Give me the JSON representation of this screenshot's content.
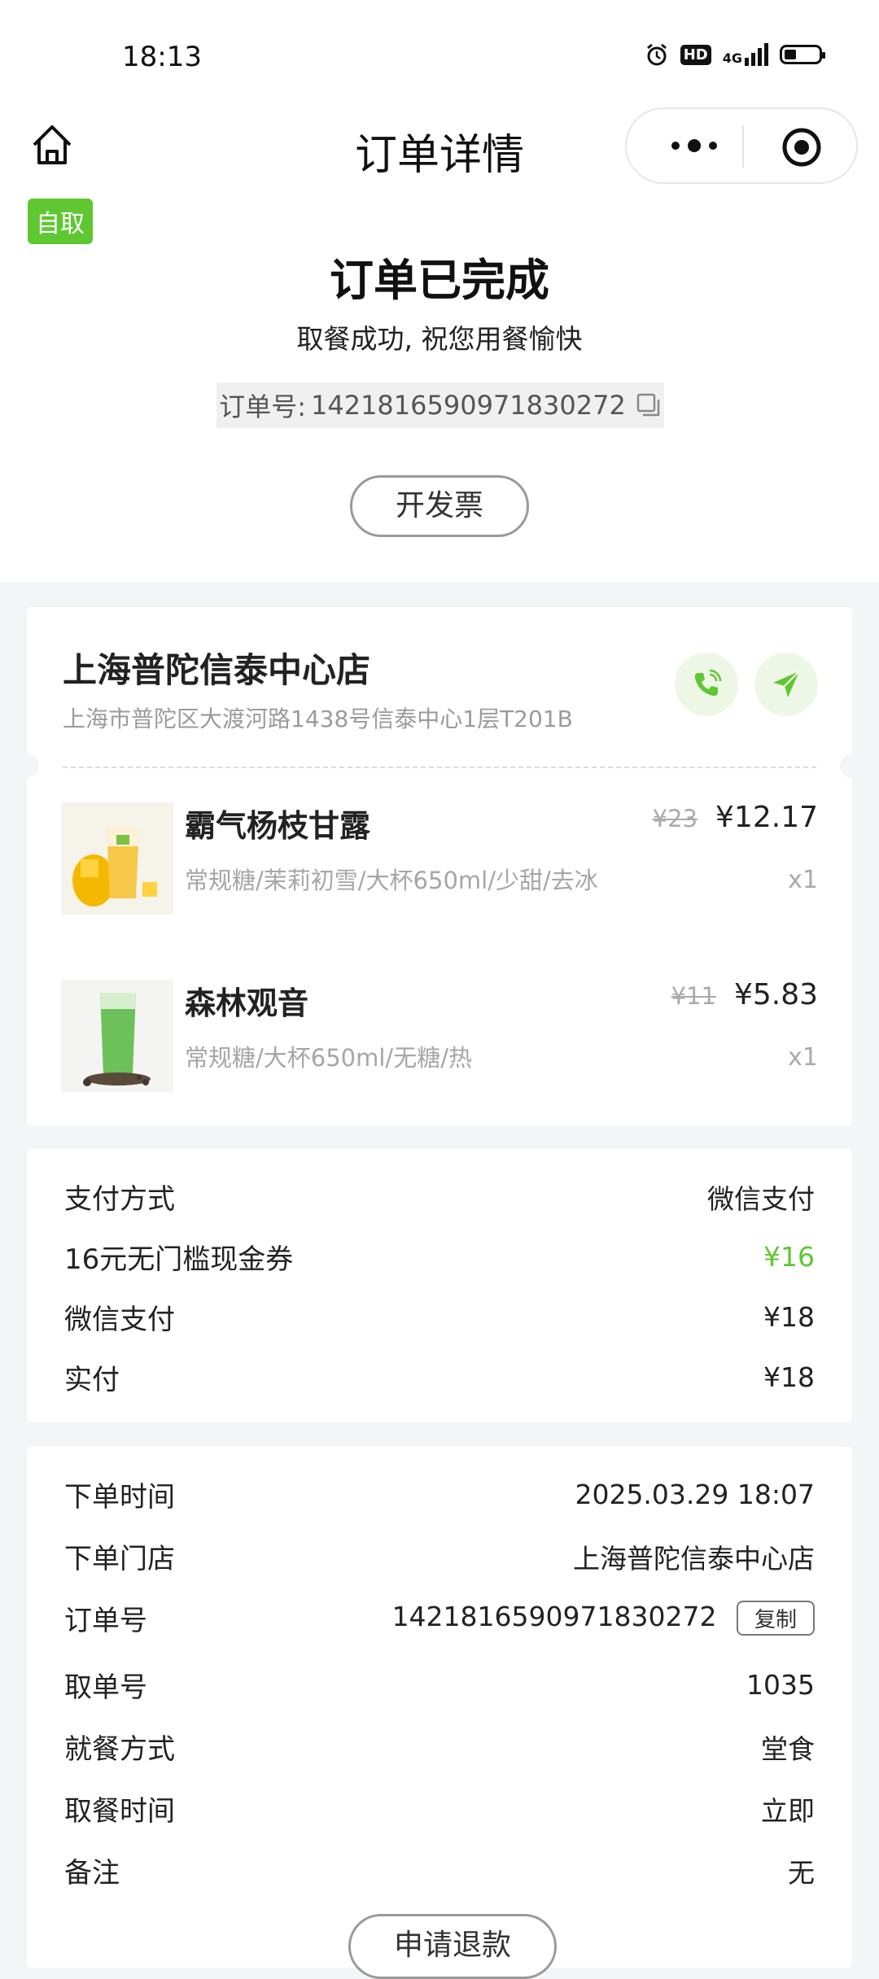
{
  "status_bar": {
    "time": "18:13",
    "hd_label": "HD",
    "network": "4G"
  },
  "nav": {
    "title": "订单详情"
  },
  "order_status": {
    "tag": "自取",
    "title": "订单已完成",
    "subtitle": "取餐成功, 祝您用餐愉快",
    "order_no_label": "订单号:",
    "order_no": "1421816590971830272",
    "invoice_button": "开发票"
  },
  "store": {
    "name": "上海普陀信泰中心店",
    "address": "上海市普陀区大渡河路1438号信泰中心1层T201B"
  },
  "products": [
    {
      "name": "霸气杨枝甘露",
      "options": "常规糖/茉莉初雪/大杯650ml/少甜/去冰",
      "original_price": "¥23",
      "price": "¥12.17",
      "qty": "x1",
      "image": "mango-drink"
    },
    {
      "name": "森林观音",
      "options": "常规糖/大杯650ml/无糖/热",
      "original_price": "¥11",
      "price": "¥5.83",
      "qty": "x1",
      "image": "green-tea-drink"
    }
  ],
  "payment": {
    "rows": [
      {
        "label": "支付方式",
        "value": "微信支付"
      },
      {
        "label": "16元无门槛现金券",
        "value": "¥16"
      },
      {
        "label": "微信支付",
        "value": "¥18"
      },
      {
        "label": "实付",
        "value": "¥18"
      }
    ],
    "accent_color": "#5fc732"
  },
  "details": {
    "rows": [
      {
        "label": "下单时间",
        "value": "2025.03.29 18:07"
      },
      {
        "label": "下单门店",
        "value": "上海普陀信泰中心店"
      },
      {
        "label": "订单号",
        "value": "1421816590971830272"
      },
      {
        "label": "取单号",
        "value": "1035"
      },
      {
        "label": "就餐方式",
        "value": "堂食"
      },
      {
        "label": "取餐时间",
        "value": "立即"
      },
      {
        "label": "备注",
        "value": "无"
      }
    ],
    "copy_button": "复制",
    "refund_button": "申请退款"
  }
}
